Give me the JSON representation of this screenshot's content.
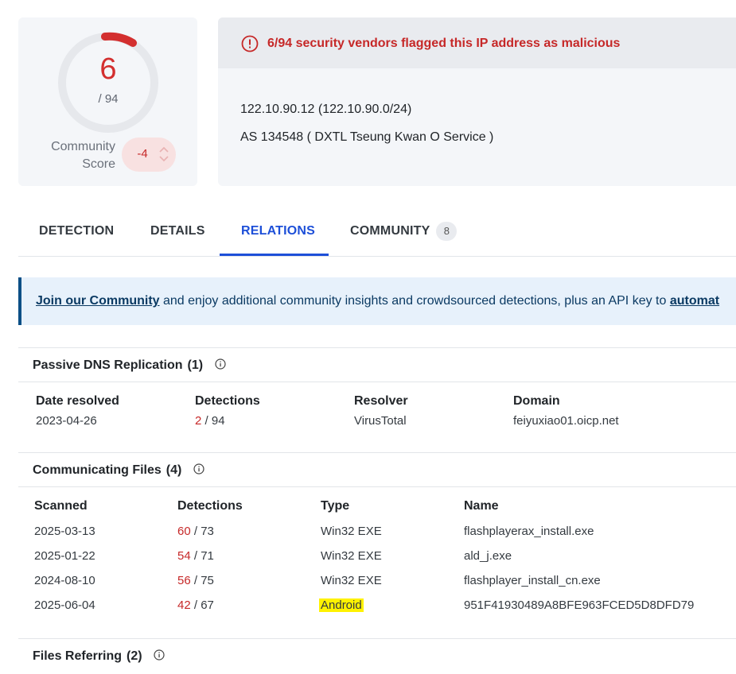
{
  "score": {
    "detections": "6",
    "total": "/ 94",
    "community_label_1": "Community",
    "community_label_2": "Score",
    "community_value": "-4"
  },
  "alert": {
    "message": "6/94 security vendors flagged this IP address as malicious",
    "ip": "122.10.90.12  (122.10.90.0/24)",
    "as": "AS 134548  ( DXTL Tseung Kwan O Service )"
  },
  "tabs": [
    {
      "label": "DETECTION"
    },
    {
      "label": "DETAILS"
    },
    {
      "label": "RELATIONS"
    },
    {
      "label": "COMMUNITY",
      "badge": "8"
    }
  ],
  "banner": {
    "link": "Join our Community",
    "text": " and enjoy additional community insights and crowdsourced detections, plus an API key to ",
    "link2": "automat"
  },
  "passive_dns": {
    "title": "Passive DNS Replication",
    "count": "(1)",
    "columns": [
      "Date resolved",
      "Detections",
      "Resolver",
      "Domain"
    ],
    "rows": [
      {
        "date": "2023-04-26",
        "det": "2",
        "det_total": " / 94",
        "resolver": "VirusTotal",
        "domain": "feiyuxiao01.oicp.net"
      }
    ]
  },
  "communicating_files": {
    "title": "Communicating Files",
    "count": "(4)",
    "columns": [
      "Scanned",
      "Detections",
      "Type",
      "Name"
    ],
    "rows": [
      {
        "scanned": "2025-03-13",
        "det": "60",
        "det_total": " / 73",
        "type": "Win32 EXE",
        "name": "flashplayerax_install.exe"
      },
      {
        "scanned": "2025-01-22",
        "det": "54",
        "det_total": " / 71",
        "type": "Win32 EXE",
        "name": "ald_j.exe"
      },
      {
        "scanned": "2024-08-10",
        "det": "56",
        "det_total": " / 75",
        "type": "Win32 EXE",
        "name": "flashplayer_install_cn.exe"
      },
      {
        "scanned": "2025-06-04",
        "det": "42",
        "det_total": " / 67",
        "type": "Android",
        "name": "951F41930489A8BFE963FCED5D8DFD79"
      }
    ]
  },
  "files_referring": {
    "title": "Files Referring",
    "count": "(2)"
  },
  "colors": {
    "accent": "#1d4fd8",
    "malicious": "#c62828",
    "highlight": "#fff200"
  },
  "icons": [
    "alert-circle-icon",
    "info-icon",
    "chevron-up-icon",
    "chevron-down-icon"
  ]
}
